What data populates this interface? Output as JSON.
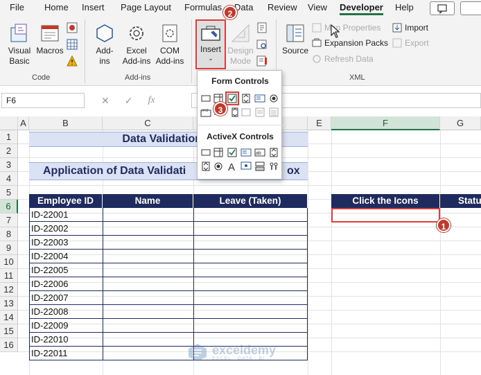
{
  "menu": {
    "items": [
      "File",
      "Home",
      "Insert",
      "Page Layout",
      "Formulas",
      "Data",
      "Review",
      "View",
      "Developer",
      "Help"
    ],
    "active": "Developer"
  },
  "ribbon": {
    "code": {
      "visual_basic": "Visual\nBasic",
      "macros": "Macros",
      "label": "Code"
    },
    "addins": {
      "addins": "Add-\nins",
      "excel_addins": "Excel\nAdd-ins",
      "com_addins": "COM\nAdd-ins",
      "label": "Add-ins"
    },
    "controls": {
      "insert": "Insert",
      "design_mode": "Design\nMode"
    },
    "xml": {
      "source": "Source",
      "map_properties": "Map Properties",
      "expansion_packs": "Expansion Packs",
      "refresh_data": "Refresh Data",
      "import": "Import",
      "export": "Export",
      "label": "XML"
    }
  },
  "formula_bar": {
    "name_box": "F6",
    "fx": "fx",
    "value": ""
  },
  "grid": {
    "columns": [
      "A",
      "B",
      "C",
      "D",
      "E",
      "F",
      "G"
    ],
    "selected_column": "F",
    "rows": [
      "1",
      "2",
      "3",
      "4",
      "5",
      "6",
      "7",
      "8",
      "9",
      "10",
      "11",
      "12",
      "13",
      "14",
      "15",
      "16"
    ],
    "selected_row": "6"
  },
  "sheet": {
    "title1": "Data Validation in",
    "title2": "Application of  Data Validati",
    "title2_tail": "ox",
    "headers": {
      "employee_id": "Employee ID",
      "name": "Name",
      "leave": "Leave (Taken)",
      "click_icons": "Click the Icons",
      "status": "Statu"
    },
    "employee_ids": [
      "ID-22001",
      "ID-22002",
      "ID-22003",
      "ID-22004",
      "ID-22005",
      "ID-22006",
      "ID-22007",
      "ID-22008",
      "ID-22009",
      "ID-22010",
      "ID-22011"
    ]
  },
  "dropdown": {
    "form_controls": "Form Controls",
    "activex_controls": "ActiveX Controls"
  },
  "badges": {
    "one": "1",
    "two": "2",
    "three": "3"
  },
  "watermark": {
    "brand": "exceldemy",
    "tagline": "EXCEL · DATA · BI"
  },
  "colors": {
    "accent": "#217346",
    "header_navy": "#1f2b5e",
    "title_fill": "#dbe2f4",
    "badge_red": "#c0392b",
    "select_red": "#e03b3b"
  }
}
